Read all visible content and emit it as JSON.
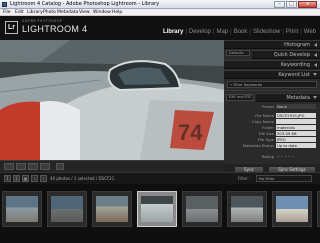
{
  "window": {
    "title": "Lightroom 4 Catalog - Adobe Photoshop Lightroom - Library",
    "controls": [
      "–",
      "□",
      "x"
    ]
  },
  "menu": [
    "File",
    "Edit",
    "Library",
    "Photo",
    "Metadata",
    "View",
    "Window",
    "Help"
  ],
  "identity": {
    "logo": "Lr",
    "subtitle": "ADOBE PHOTOSHOP",
    "product": "LIGHTROOM 4"
  },
  "modules": [
    "Library",
    "Develop",
    "Map",
    "Book",
    "Slideshow",
    "Print",
    "Web"
  ],
  "active_module": "Library",
  "right_panel": {
    "histogram": "Histogram",
    "preset_label": "Defaults",
    "quick_develop": "Quick Develop",
    "keywording": "Keywording",
    "keyword_list": "Keyword List",
    "filter_placeholder": "Filter Keywords",
    "metadata": "Metadata",
    "metadata_preset_label": "Preset",
    "metadata_preset_value": "None",
    "exif_label": "EXIF and IPTC",
    "fields": [
      {
        "label": "File Name",
        "value": "DSCF2915.JPG"
      },
      {
        "label": "Copy Name",
        "value": ""
      },
      {
        "label": "Folder",
        "value": "materials"
      },
      {
        "label": "File Size",
        "value": "503.59 KB"
      },
      {
        "label": "File Type",
        "value": "JPEG"
      },
      {
        "label": "Metadata Status",
        "value": "Up to date"
      }
    ],
    "rating_label": "Rating",
    "sync": "Sync",
    "sync_settings": "Sync Settings"
  },
  "filmstrip": {
    "info": "40 photos / 1 selected / DSCF21",
    "filter_label": "Filter :",
    "filter_value": "No Filter",
    "nav_back": "‹",
    "nav_fwd": "›",
    "grid_icon": "grid-icon",
    "selected_index": 4
  },
  "colors": {
    "active_module": "#ffffff",
    "inactive_module": "#8c8c8c",
    "panel_bg": "#2a2a2a",
    "plate_bg": "#111111"
  }
}
